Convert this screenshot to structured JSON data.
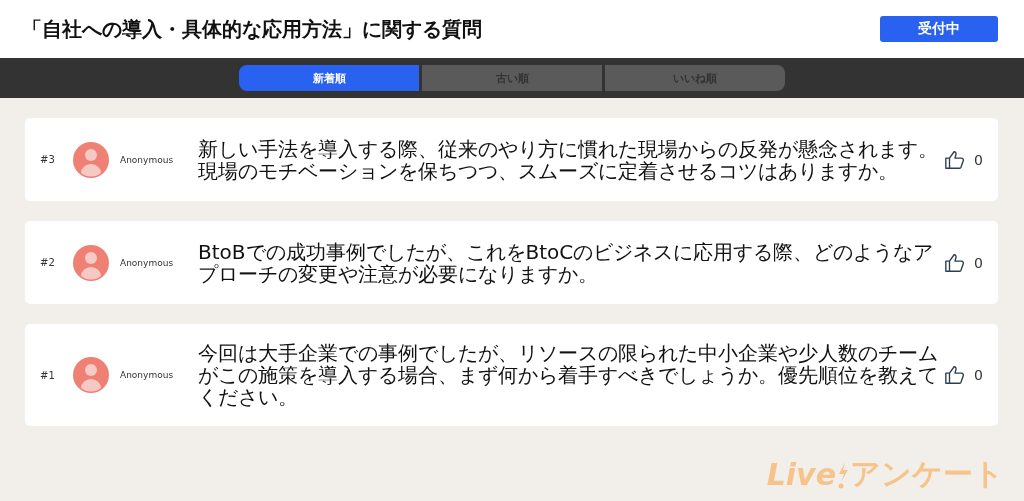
{
  "header": {
    "title": "「自社への導入・具体的な応用方法」に関する質問",
    "status": "受付中"
  },
  "tabs": [
    {
      "label": "新着順",
      "selected": true
    },
    {
      "label": "古い順",
      "selected": false
    },
    {
      "label": "いいね順",
      "selected": false
    }
  ],
  "questions": [
    {
      "number": "#3",
      "author": "Anonymous",
      "text": "新しい手法を導入する際、従来のやり方に慣れた現場からの反発が懸念されます。現場のモチベーションを保ちつつ、スムーズに定着させるコツはありますか。",
      "likes": "0"
    },
    {
      "number": "#2",
      "author": "Anonymous",
      "text": "BtoBでの成功事例でしたが、これをBtoCのビジネスに応用する際、どのようなアプローチの変更や注意が必要になりますか。",
      "likes": "0"
    },
    {
      "number": "#1",
      "author": "Anonymous",
      "text": "今回は大手企業での事例でしたが、リソースの限られた中小企業や少人数のチームがこの施策を導入する場合、まず何から着手すべきでしょうか。優先順位を教えてください。",
      "likes": "0"
    }
  ],
  "logo": {
    "left": "Live",
    "right": "アンケート"
  }
}
